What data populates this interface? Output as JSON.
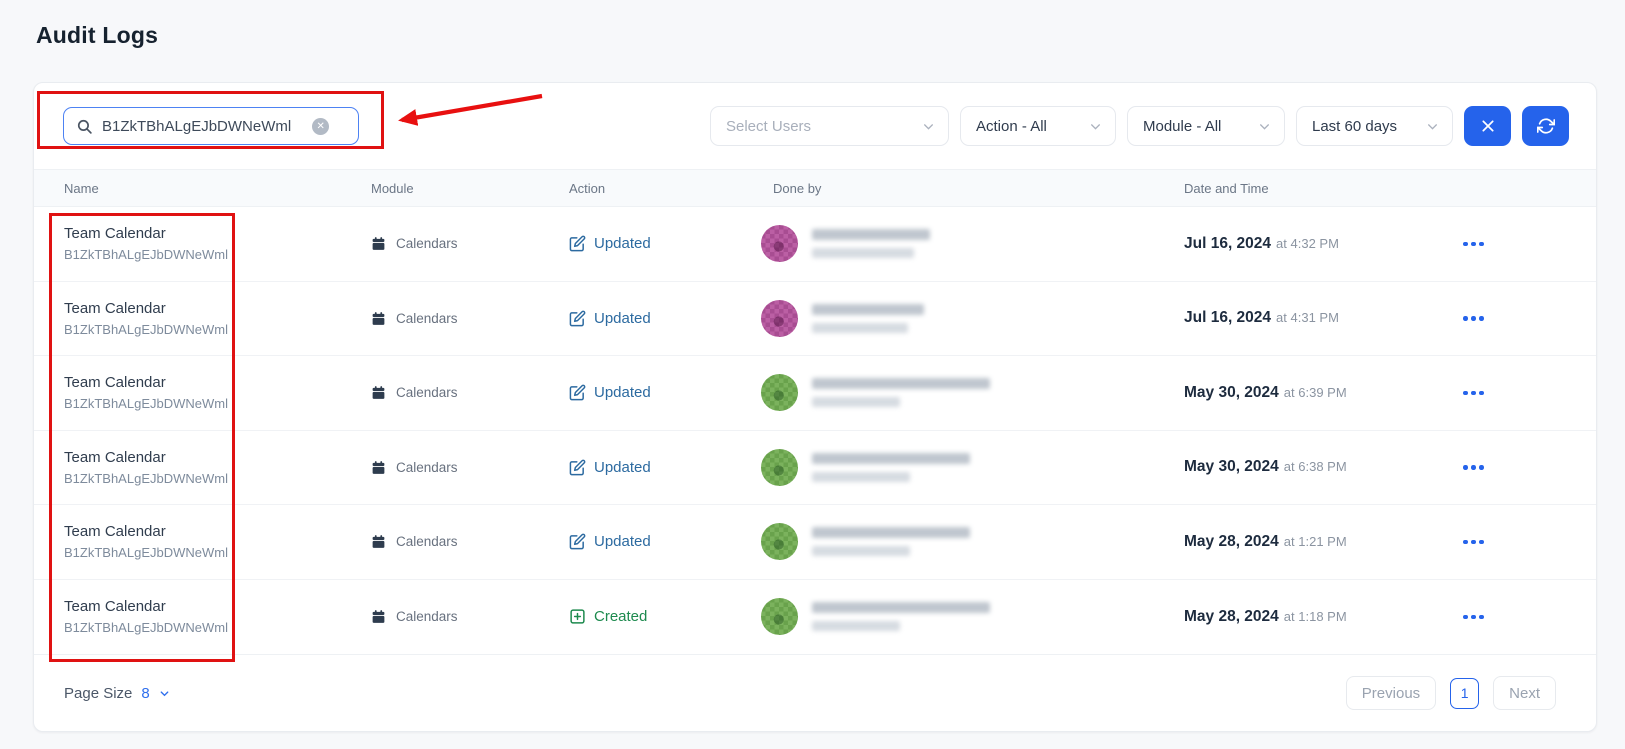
{
  "page": {
    "title": "Audit Logs"
  },
  "toolbar": {
    "search": {
      "value": "B1ZkTBhALgEJbDWNeWml",
      "clear_icon": "✕"
    },
    "filters": [
      {
        "label": "Select Users",
        "is_placeholder": true
      },
      {
        "label": "Action - All",
        "is_placeholder": false
      },
      {
        "label": "Module - All",
        "is_placeholder": false
      },
      {
        "label": "Last 60 days",
        "is_placeholder": false
      }
    ]
  },
  "table": {
    "columns": [
      "Name",
      "Module",
      "Action",
      "Done by",
      "Date and Time"
    ],
    "rows": [
      {
        "name": "Team Calendar",
        "id": "B1ZkTBhALgEJbDWNeWml",
        "module": "Calendars",
        "action": "Updated",
        "action_type": "updated",
        "date": "Jul 16, 2024",
        "time": "at 4:32 PM",
        "avatar_color": "pink",
        "redact_w1": 118,
        "redact_w2": 102
      },
      {
        "name": "Team Calendar",
        "id": "B1ZkTBhALgEJbDWNeWml",
        "module": "Calendars",
        "action": "Updated",
        "action_type": "updated",
        "date": "Jul 16, 2024",
        "time": "at 4:31 PM",
        "avatar_color": "pink",
        "redact_w1": 112,
        "redact_w2": 96
      },
      {
        "name": "Team Calendar",
        "id": "B1ZkTBhALgEJbDWNeWml",
        "module": "Calendars",
        "action": "Updated",
        "action_type": "updated",
        "date": "May 30, 2024",
        "time": "at 6:39 PM",
        "avatar_color": "green",
        "redact_w1": 178,
        "redact_w2": 88
      },
      {
        "name": "Team Calendar",
        "id": "B1ZkTBhALgEJbDWNeWml",
        "module": "Calendars",
        "action": "Updated",
        "action_type": "updated",
        "date": "May 30, 2024",
        "time": "at 6:38 PM",
        "avatar_color": "green",
        "redact_w1": 158,
        "redact_w2": 98
      },
      {
        "name": "Team Calendar",
        "id": "B1ZkTBhALgEJbDWNeWml",
        "module": "Calendars",
        "action": "Updated",
        "action_type": "updated",
        "date": "May 28, 2024",
        "time": "at 1:21 PM",
        "avatar_color": "green",
        "redact_w1": 158,
        "redact_w2": 98
      },
      {
        "name": "Team Calendar",
        "id": "B1ZkTBhALgEJbDWNeWml",
        "module": "Calendars",
        "action": "Created",
        "action_type": "created",
        "date": "May 28, 2024",
        "time": "at 1:18 PM",
        "avatar_color": "green",
        "redact_w1": 178,
        "redact_w2": 88
      }
    ]
  },
  "footer": {
    "page_size_label": "Page Size",
    "page_size_value": "8",
    "previous_label": "Previous",
    "current_page": "1",
    "next_label": "Next"
  },
  "colors": {
    "accent_blue": "#2563eb",
    "action_updated": "#2c6aa0",
    "action_created": "#1d8a4e",
    "annotation_red": "#e01212"
  }
}
